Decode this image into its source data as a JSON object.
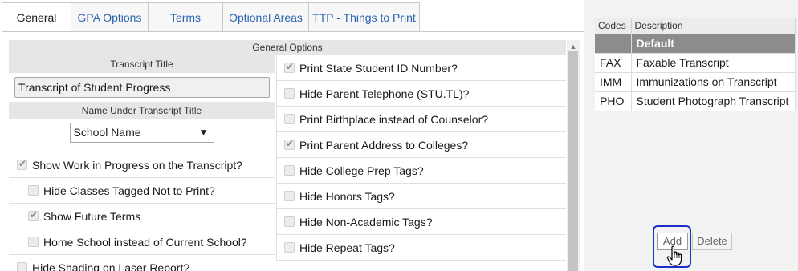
{
  "tabs": [
    {
      "label": "General",
      "active": true
    },
    {
      "label": "GPA Options",
      "active": false
    },
    {
      "label": "Terms",
      "active": false
    },
    {
      "label": "Optional Areas",
      "active": false
    },
    {
      "label": "TTP - Things to Print",
      "active": false
    }
  ],
  "general_options": {
    "header": "General Options",
    "transcript_title_label": "Transcript Title",
    "transcript_title_value": "Transcript of Student Progress",
    "name_under_label": "Name Under Transcript Title",
    "name_under_value": "School Name",
    "left_checks": [
      {
        "label": "Show Work in Progress on the Transcript?",
        "checked": true
      },
      {
        "label": "Hide Classes Tagged Not to Print?",
        "checked": false
      },
      {
        "label": "Show Future Terms",
        "checked": true
      },
      {
        "label": "Home School instead of Current School?",
        "checked": false
      },
      {
        "label": "Hide Shading on Laser Report?",
        "checked": false
      }
    ],
    "right_checks": [
      {
        "label": "Print State Student ID Number?",
        "checked": true
      },
      {
        "label": "Hide Parent Telephone (STU.TL)?",
        "checked": false
      },
      {
        "label": "Print Birthplace instead of Counselor?",
        "checked": false
      },
      {
        "label": "Print Parent Address to Colleges?",
        "checked": true
      },
      {
        "label": "Hide College Prep Tags?",
        "checked": false
      },
      {
        "label": "Hide Honors Tags?",
        "checked": false
      },
      {
        "label": "Hide Non-Academic Tags?",
        "checked": false
      },
      {
        "label": "Hide Repeat Tags?",
        "checked": false
      }
    ]
  },
  "codes_table": {
    "headers": [
      "Codes",
      "Description"
    ],
    "rows": [
      {
        "code": "",
        "description": "Default",
        "selected": true
      },
      {
        "code": "FAX",
        "description": "Faxable Transcript",
        "selected": false
      },
      {
        "code": "IMM",
        "description": "Immunizations on Transcript",
        "selected": false
      },
      {
        "code": "PHO",
        "description": "Student Photograph Transcript",
        "selected": false
      }
    ]
  },
  "buttons": {
    "add": "Add",
    "delete": "Delete"
  },
  "colors": {
    "tab_link": "#2a62b0",
    "selected_row": "#8c8c8c",
    "highlight_box": "#1d2fc6"
  }
}
